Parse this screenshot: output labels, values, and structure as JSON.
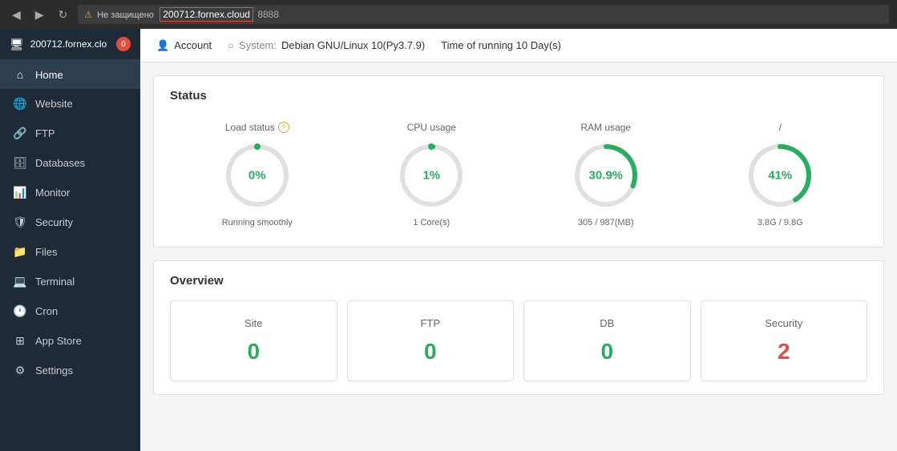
{
  "browser": {
    "warning_text": "Не защищено",
    "url_highlighted": "200712.fornex.cloud",
    "url_port": "8888",
    "back_icon": "◀",
    "forward_icon": "▶",
    "reload_icon": "↻"
  },
  "sidebar": {
    "header": {
      "text": "200712.fornex.clo",
      "badge": "0"
    },
    "items": [
      {
        "label": "Home",
        "icon": "⌂",
        "active": true
      },
      {
        "label": "Website",
        "icon": "🌐"
      },
      {
        "label": "FTP",
        "icon": "🔗"
      },
      {
        "label": "Databases",
        "icon": "🗄"
      },
      {
        "label": "Monitor",
        "icon": "📊"
      },
      {
        "label": "Security",
        "icon": "🛡"
      },
      {
        "label": "Files",
        "icon": "📁"
      },
      {
        "label": "Terminal",
        "icon": "💻"
      },
      {
        "label": "Cron",
        "icon": "🕐"
      },
      {
        "label": "App Store",
        "icon": "⊞"
      },
      {
        "label": "Settings",
        "icon": "⚙"
      }
    ]
  },
  "topbar": {
    "account_label": "Account",
    "system_label": "System:",
    "system_value": "Debian GNU/Linux 10(Py3.7.9)",
    "uptime_label": "Time of running 10 Day(s)"
  },
  "status": {
    "section_title": "Status",
    "gauges": [
      {
        "label": "Load status",
        "has_question": true,
        "value_text": "0%",
        "value_num": 0,
        "sublabel": "Running smoothly",
        "color": "#27ae60"
      },
      {
        "label": "CPU usage",
        "has_question": false,
        "value_text": "1%",
        "value_num": 1,
        "sublabel": "1 Core(s)",
        "color": "#27ae60"
      },
      {
        "label": "RAM usage",
        "has_question": false,
        "value_text": "30.9%",
        "value_num": 30.9,
        "sublabel": "305 / 987(MB)",
        "color": "#27ae60"
      },
      {
        "label": "/",
        "has_question": false,
        "value_text": "41%",
        "value_num": 41,
        "sublabel": "3.8G / 9.8G",
        "color": "#27ae60"
      }
    ]
  },
  "overview": {
    "section_title": "Overview",
    "cards": [
      {
        "label": "Site",
        "value": "0",
        "color": "green"
      },
      {
        "label": "FTP",
        "value": "0",
        "color": "green"
      },
      {
        "label": "DB",
        "value": "0",
        "color": "green"
      },
      {
        "label": "Security",
        "value": "2",
        "color": "red"
      }
    ]
  }
}
